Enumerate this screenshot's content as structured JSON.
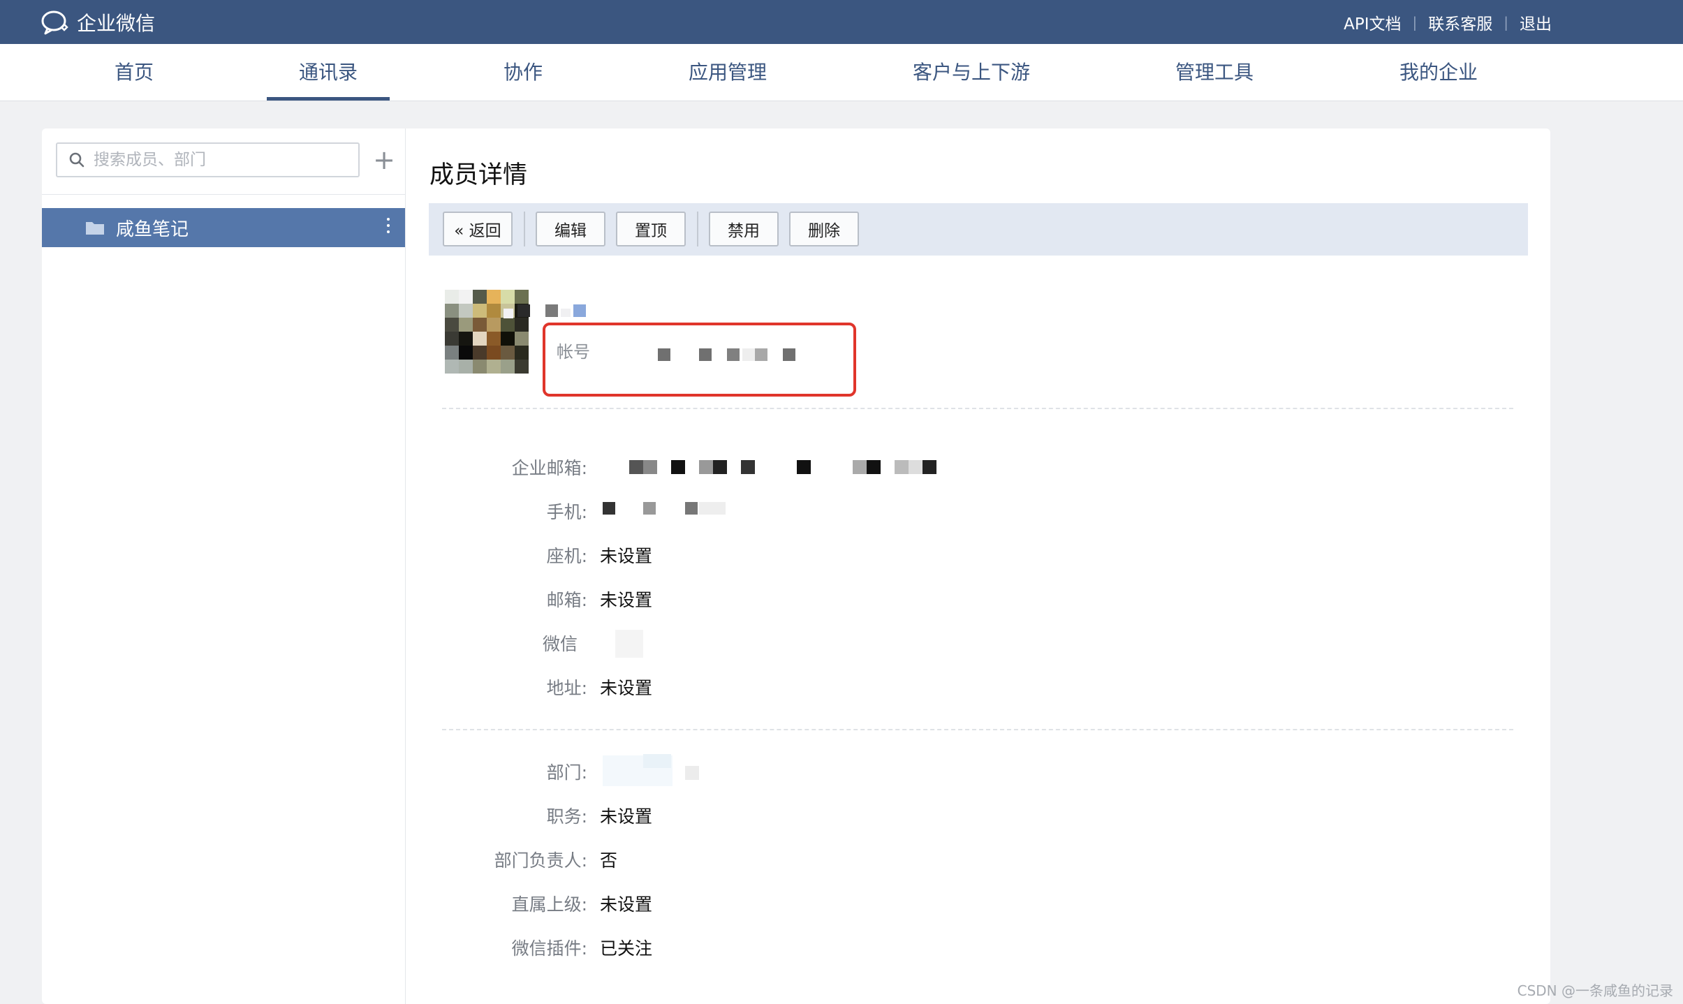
{
  "app": {
    "name": "企业微信"
  },
  "top_links": [
    "API文档",
    "联系客服",
    "退出"
  ],
  "nav": {
    "tabs": [
      {
        "label": "首页",
        "active": false
      },
      {
        "label": "通讯录",
        "active": true
      },
      {
        "label": "协作",
        "active": false
      },
      {
        "label": "应用管理",
        "active": false
      },
      {
        "label": "客户与上下游",
        "active": false
      },
      {
        "label": "管理工具",
        "active": false
      },
      {
        "label": "我的企业",
        "active": false
      }
    ]
  },
  "sidebar": {
    "search_placeholder": "搜索成员、部门",
    "add_icon": "plus-icon",
    "department": {
      "name": "咸鱼笔记",
      "icon": "folder-icon"
    }
  },
  "detail": {
    "title": "成员详情",
    "buttons": {
      "back": "« 返回",
      "edit": "编辑",
      "pin": "置顶",
      "disable": "禁用",
      "delete": "删除"
    },
    "account_label": "帐号",
    "contact": [
      {
        "label": "企业邮箱:",
        "value": ""
      },
      {
        "label": "手机:",
        "value": ""
      },
      {
        "label": "座机:",
        "value": "未设置"
      },
      {
        "label": "邮箱:",
        "value": "未设置"
      },
      {
        "label": "微信",
        "value": ""
      },
      {
        "label": "地址:",
        "value": "未设置"
      }
    ],
    "org": [
      {
        "label": "部门:",
        "value": ""
      },
      {
        "label": "职务:",
        "value": "未设置"
      },
      {
        "label": "部门负责人:",
        "value": "否"
      },
      {
        "label": "直属上级:",
        "value": "未设置"
      },
      {
        "label": "微信插件:",
        "value": "已关注"
      }
    ]
  },
  "watermark": "CSDN @一条咸鱼的记录",
  "colors": {
    "header": "#3b5680",
    "selected_dept": "#5577aa",
    "highlight_box": "#e0352b",
    "toolbar_bg": "#e2e8f2"
  }
}
